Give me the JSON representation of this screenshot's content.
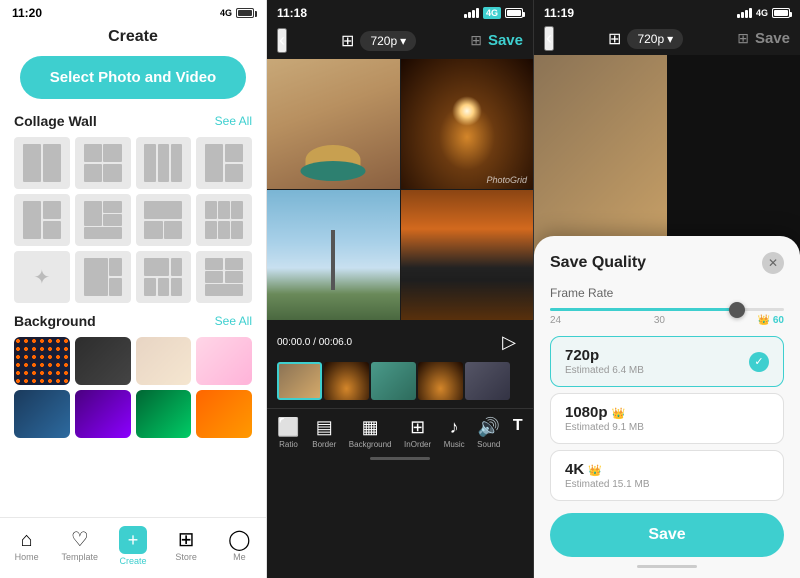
{
  "panel1": {
    "status": {
      "time": "11:20",
      "signal": "4G",
      "battery": "100"
    },
    "title": "Create",
    "select_btn": "Select Photo and Video",
    "collage_section": {
      "title": "Collage Wall",
      "see_all": "See All"
    },
    "background_section": {
      "title": "Background",
      "see_all": "See All"
    },
    "nav": {
      "home": "Home",
      "template": "Template",
      "create": "Create",
      "store": "Store",
      "me": "Me"
    }
  },
  "panel2": {
    "status": {
      "time": "11:18",
      "signal": "4G",
      "battery": "100"
    },
    "quality": "720p",
    "save": "Save",
    "time_display": "00:00.0 / 00:06.0",
    "tools": [
      "Ratio",
      "Border",
      "Background",
      "InOrder",
      "Music",
      "Sound",
      "T"
    ]
  },
  "panel3": {
    "status": {
      "time": "11:19",
      "signal": "4G",
      "battery": "100"
    },
    "quality": "720p",
    "save": "Save",
    "modal": {
      "title": "Save Quality",
      "frame_rate_label": "Frame Rate",
      "slider_min": "24",
      "slider_mid": "30",
      "slider_max": "60",
      "quality_options": [
        {
          "name": "720p",
          "size": "Estimated 6.4 MB",
          "selected": true,
          "premium": false
        },
        {
          "name": "1080p",
          "size": "Estimated 9.1 MB",
          "selected": false,
          "premium": true
        },
        {
          "name": "4K",
          "size": "Estimated 15.1 MB",
          "selected": false,
          "premium": true
        }
      ],
      "save_btn": "Save"
    }
  }
}
